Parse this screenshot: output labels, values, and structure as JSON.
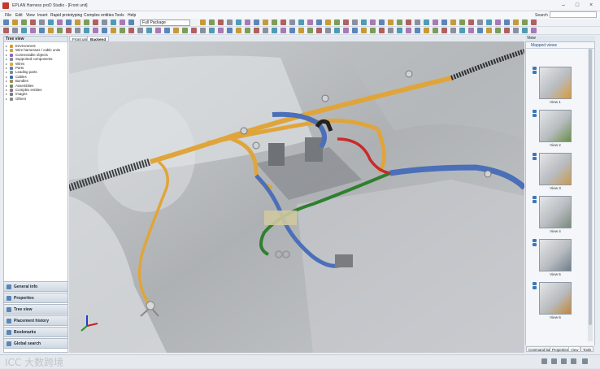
{
  "window": {
    "title": "EPLAN Harness proD Studio - [Front unit]"
  },
  "menu": {
    "items": [
      "File",
      "Edit",
      "View",
      "Insert",
      "Rapid prototyping",
      "Complex entities",
      "Tools",
      "Help"
    ]
  },
  "search": {
    "label": "Search"
  },
  "toolbar": {
    "package_combo": "Full Package"
  },
  "tree_view": {
    "title": "Tree view",
    "items": [
      {
        "label": "Environment",
        "color": "#d99a2b"
      },
      {
        "label": "Wire harnesses / cable units",
        "color": "#d4a040"
      },
      {
        "label": "Connectable objects",
        "color": "#8a6bb0"
      },
      {
        "label": "Supported components",
        "color": "#7a8b9a"
      },
      {
        "label": "Wires",
        "color": "#e2a83a"
      },
      {
        "label": "Parts",
        "color": "#5c7fa3"
      },
      {
        "label": "Leading parts",
        "color": "#6e8fb0"
      },
      {
        "label": "Cables",
        "color": "#3a6ea5"
      },
      {
        "label": "Bundles",
        "color": "#a88850"
      },
      {
        "label": "Assemblies",
        "color": "#6d8f5a"
      },
      {
        "label": "Complex entities",
        "color": "#8e6f9a"
      },
      {
        "label": "Images",
        "color": "#7a7a7a"
      },
      {
        "label": "Others",
        "color": "#888888"
      }
    ]
  },
  "nav": {
    "sections": [
      "General info",
      "Properties",
      "Tree view",
      "Placement history",
      "Bookmarks",
      "Global search"
    ]
  },
  "doc_tabs": [
    "Front unit",
    "Backend"
  ],
  "view_panel": {
    "title": "View",
    "mapped_views_title": "Mapped views",
    "views": [
      "View 1",
      "View 2",
      "View 3",
      "View 4",
      "View 5",
      "View 6"
    ]
  },
  "right_tabs": [
    "Command bar",
    "Properties",
    "View",
    "Tools"
  ],
  "watermark": "ICC 大数跨境",
  "colors": {
    "wire_orange": "#e0a53a",
    "wire_blue": "#4b6fb8",
    "wire_green": "#2f7f2f",
    "wire_red": "#c92a2a",
    "ui_accent": "#3e78b8"
  }
}
